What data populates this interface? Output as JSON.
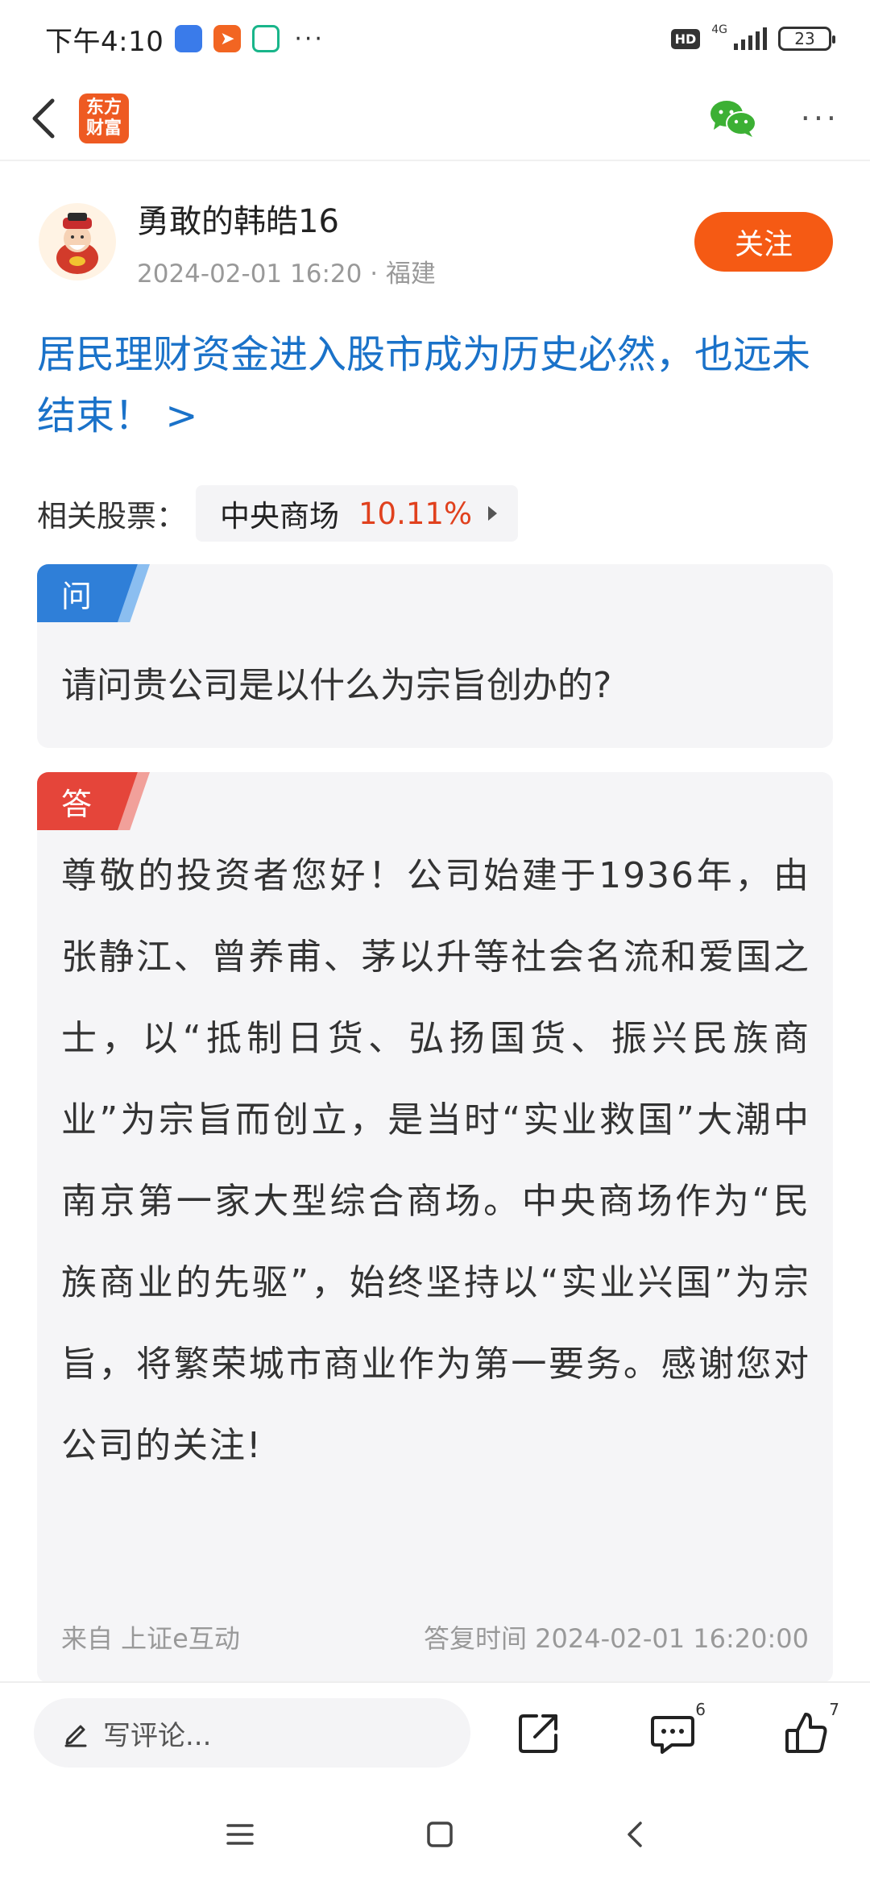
{
  "status_bar": {
    "time": "下午4:10",
    "overflow": "···",
    "hd_label": "HD",
    "network": "4G",
    "battery": "23"
  },
  "nav": {
    "logo_line1": "东方",
    "logo_line2": "财富",
    "more": "···"
  },
  "post": {
    "author": "勇敢的韩皓16",
    "meta": "2024-02-01 16:20 · 福建",
    "follow_label": "关注",
    "title": "居民理财资金进入股市成为历史必然，也远未结束！ >"
  },
  "related": {
    "label": "相关股票：",
    "stock_name": "中央商场",
    "stock_change": "10.11%"
  },
  "question": {
    "tag": "问",
    "text": "请问贵公司是以什么为宗旨创办的?"
  },
  "answer": {
    "tag": "答",
    "text": "尊敬的投资者您好！公司始建于1936年，由张静江、曾养甫、茅以升等社会名流和爱国之士，以“抵制日货、弘扬国货、振兴民族商业”为宗旨而创立，是当时“实业救国”大潮中南京第一家大型综合商场。中央商场作为“民族商业的先驱”，始终坚持以“实业兴国”为宗旨，将繁荣城市商业作为第一要务。感谢您对公司的关注!",
    "source": "来自 上证e互动",
    "reply_time": "答复时间 2024-02-01 16:20:00"
  },
  "bottom_bar": {
    "comment_placeholder": "写评论...",
    "comment_count": "6",
    "like_count": "7"
  },
  "colors": {
    "brand_orange": "#f55a14",
    "link_blue": "#1a72c9",
    "question_tag": "#2f7fd8",
    "answer_tag": "#e5453a",
    "rise_red": "#e0411e"
  }
}
